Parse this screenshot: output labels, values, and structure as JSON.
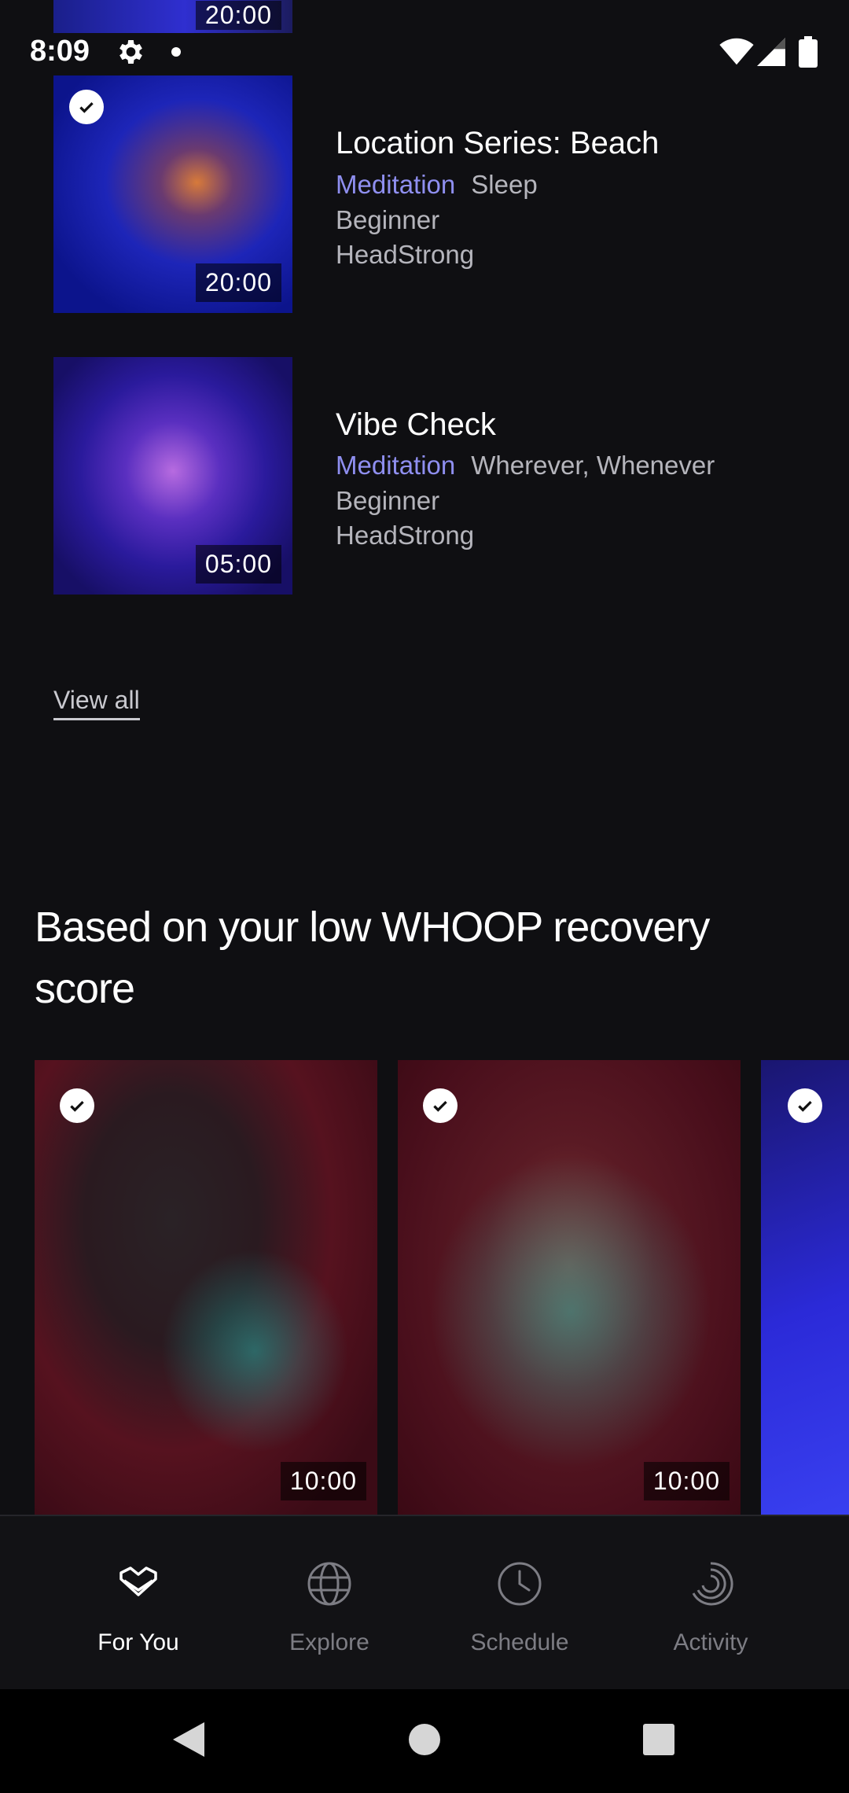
{
  "status_bar": {
    "time": "8:09"
  },
  "top_partial": {
    "duration": "20:00"
  },
  "list_items": [
    {
      "title": "Location Series: Beach",
      "category": "Meditation",
      "tag": "Sleep",
      "level": "Beginner",
      "provider": "HeadStrong",
      "duration": "20:00",
      "completed": true
    },
    {
      "title": "Vibe Check",
      "category": "Meditation",
      "tag": "Wherever, Whenever",
      "level": "Beginner",
      "provider": "HeadStrong",
      "duration": "05:00",
      "completed": false
    }
  ],
  "view_all_label": "View all",
  "recovery_section": {
    "title": "Based on your low WHOOP recovery score",
    "cards": [
      {
        "duration": "10:00",
        "completed": true
      },
      {
        "duration": "10:00",
        "completed": true
      },
      {
        "duration": "",
        "completed": true
      }
    ]
  },
  "bottom_nav": [
    {
      "label": "For You",
      "icon": "heart-chevron-icon",
      "active": true
    },
    {
      "label": "Explore",
      "icon": "globe-icon",
      "active": false
    },
    {
      "label": "Schedule",
      "icon": "clock-icon",
      "active": false
    },
    {
      "label": "Activity",
      "icon": "activity-ring-icon",
      "active": false
    }
  ],
  "colors": {
    "background": "#0f0f12",
    "accent": "#8f8ff0",
    "muted_text": "#b5b5bc"
  }
}
